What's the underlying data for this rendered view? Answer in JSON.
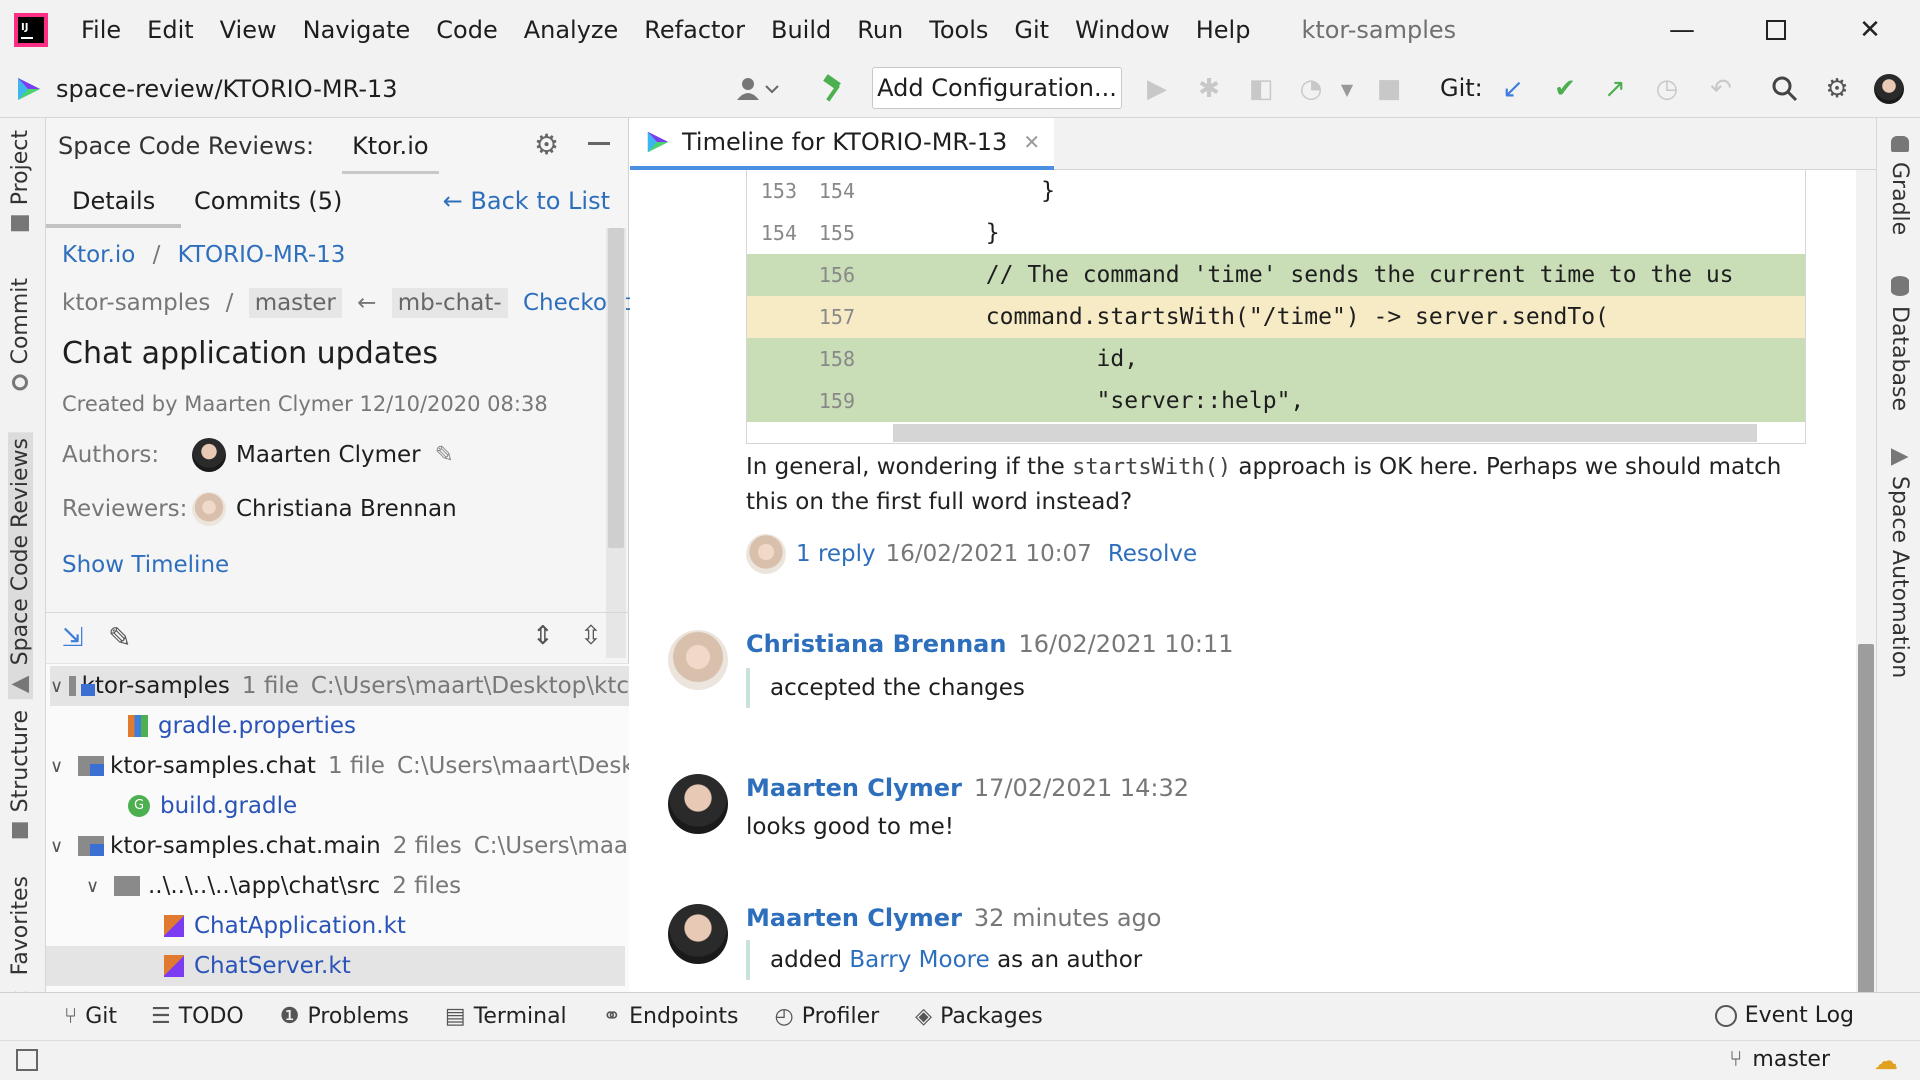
{
  "menubar": {
    "items": [
      "File",
      "Edit",
      "View",
      "Navigate",
      "Code",
      "Analyze",
      "Refactor",
      "Build",
      "Run",
      "Tools",
      "Git",
      "Window",
      "Help"
    ],
    "window_title": "ktor-samples"
  },
  "toolbar": {
    "project_path": "space-review/KTORIO-MR-13",
    "add_configuration": "Add Configuration...",
    "git_label": "Git:"
  },
  "left_strip": {
    "tabs": [
      "Project",
      "Commit",
      "Space Code Reviews",
      "Structure",
      "Favorites"
    ]
  },
  "right_strip": {
    "tabs": [
      "Gradle",
      "Database",
      "Space Automation"
    ]
  },
  "panel": {
    "title": "Space Code Reviews:",
    "tab": "Ktor.io",
    "details_tab": "Details",
    "commits_tab": "Commits (5)",
    "back_to_list": "← Back to List",
    "breadcrumb_project": "Ktor.io",
    "breadcrumb_sep": "/",
    "breadcrumb_review": "KTORIO-MR-13",
    "repo": "ktor-samples",
    "repo_sep": "/",
    "target_branch": "master",
    "arrow": "←",
    "source_branch": "mb-chat-",
    "checkout": "Checkout",
    "review_title": "Chat application updates",
    "created_by": "Created by Maarten Clymer 12/10/2020 08:38",
    "authors_label": "Authors:",
    "author": "Maarten Clymer",
    "reviewers_label": "Reviewers:",
    "reviewer": "Christiana Brennan",
    "show_timeline": "Show Timeline"
  },
  "tree": {
    "nodes": [
      {
        "name": "ktor-samples",
        "count": "1 file",
        "path": "C:\\Users\\maart\\Desktop\\ktc"
      },
      {
        "name": "gradle.properties"
      },
      {
        "name": "ktor-samples.chat",
        "count": "1 file",
        "path": "C:\\Users\\maart\\Deskto"
      },
      {
        "name": "build.gradle"
      },
      {
        "name": "ktor-samples.chat.main",
        "count": "2 files",
        "path": "C:\\Users\\maart\\["
      },
      {
        "name": "..\\..\\..\\..\\app\\chat\\src",
        "count": "2 files"
      },
      {
        "name": "ChatApplication.kt"
      },
      {
        "name": "ChatServer.kt"
      }
    ]
  },
  "editor": {
    "tab_title": "Timeline for KTORIO-MR-13",
    "diff_lines": [
      {
        "old": "153",
        "new": "154",
        "code": "            }",
        "kind": "ctx"
      },
      {
        "old": "154",
        "new": "155",
        "code": "        }",
        "kind": "ctx"
      },
      {
        "old": "",
        "new": "156",
        "code": "        // The command 'time' sends the current time to the us",
        "kind": "added"
      },
      {
        "old": "",
        "new": "157",
        "code": "        command.startsWith(\"/time\") -> server.sendTo(",
        "kind": "changed"
      },
      {
        "old": "",
        "new": "158",
        "code": "                id,",
        "kind": "added"
      },
      {
        "old": "",
        "new": "159",
        "code": "                \"server::help\",",
        "kind": "added"
      }
    ],
    "comment_part1": "In general, wondering if the ",
    "comment_code": "startsWith()",
    "comment_part2": " approach is OK here. Perhaps we should match this on the first full word instead?",
    "reply_link": "1 reply",
    "reply_date": "16/02/2021 10:07",
    "resolve": "Resolve",
    "events": [
      {
        "author": "Christiana Brennan",
        "time": "16/02/2021 10:11",
        "text": "accepted the changes"
      },
      {
        "author": "Maarten Clymer",
        "time": "17/02/2021 14:32",
        "text": "looks good to me!"
      },
      {
        "author": "Maarten Clymer",
        "time": "32 minutes ago",
        "text_before": "added ",
        "mention": "Barry Moore",
        "text_after": " as an author"
      }
    ]
  },
  "bottom_bar": {
    "items": [
      "Git",
      "TODO",
      "Problems",
      "Terminal",
      "Endpoints",
      "Profiler",
      "Packages"
    ],
    "event_log": "Event Log"
  },
  "status": {
    "branch": "master"
  },
  "colors": {
    "accent": "#2e6fbd",
    "added": "#c9deb7",
    "changed": "#f7ebc6"
  }
}
